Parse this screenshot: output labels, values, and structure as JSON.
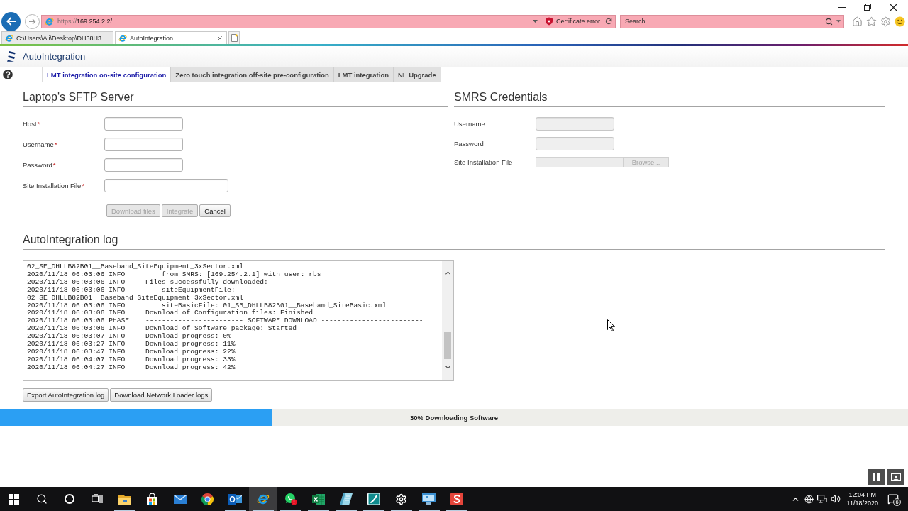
{
  "browser": {
    "tabs": [
      {
        "label": "C:\\Users\\Ali\\Desktop\\DH38H3...",
        "selected": false
      },
      {
        "label": "AutoIntegration",
        "selected": true
      }
    ],
    "address": {
      "scheme": "https://",
      "host": "169.254.2.2/"
    },
    "certificate": "Certificate error",
    "search": {
      "placeholder": "Search..."
    }
  },
  "app": {
    "title": "AutoIntegration"
  },
  "tabs": [
    {
      "label": "LMT integration on-site configuration",
      "selected": true
    },
    {
      "label": "Zero touch integration off-site pre-configuration",
      "selected": false
    },
    {
      "label": "LMT integration",
      "selected": false
    },
    {
      "label": "NL Upgrade",
      "selected": false
    }
  ],
  "required_mark": "*",
  "sftp_server": {
    "title": "Laptop's SFTP Server",
    "fields": [
      {
        "label": "Host",
        "required": true,
        "disabled": false,
        "kind": "text"
      },
      {
        "label": "Username",
        "required": true,
        "disabled": false,
        "kind": "text"
      },
      {
        "label": "Password",
        "required": true,
        "disabled": false,
        "kind": "text"
      },
      {
        "label": "Site Installation File",
        "required": true,
        "disabled": false,
        "kind": "path"
      }
    ],
    "buttons": [
      {
        "label": "Download files",
        "disabled": true
      },
      {
        "label": "Integrate",
        "disabled": true
      },
      {
        "label": "Cancel",
        "disabled": false
      }
    ]
  },
  "smrs_credentials": {
    "title": "SMRS Credentials",
    "fields": [
      {
        "label": "Username",
        "required": false,
        "disabled": true,
        "kind": "text"
      },
      {
        "label": "Password",
        "required": false,
        "disabled": true,
        "kind": "text"
      },
      {
        "label": "Site Installation File",
        "required": false,
        "disabled": true,
        "kind": "file",
        "button": "Browse..."
      }
    ]
  },
  "log": {
    "title": "AutoIntegration log",
    "lines": [
      "02_SE_DHLLB82B01__Baseband_SiteEquipment_3xSector.xml",
      "2020/11/18 06:03:06 INFO         from SMRS: [169.254.2.1] with user: rbs",
      "2020/11/18 06:03:06 INFO     Files successfully downloaded:",
      "2020/11/18 06:03:06 INFO         siteEquipmentFile:",
      "02_SE_DHLLB82B01__Baseband_SiteEquipment_3xSector.xml",
      "2020/11/18 06:03:06 INFO         siteBasicFile: 01_SB_DHLLB82B01__Baseband_SiteBasic.xml",
      "2020/11/18 06:03:06 INFO     Download of Configuration files: Finished",
      "2020/11/18 06:03:06 PHASE    ------------------------ SOFTWARE DOWNLOAD -------------------------",
      "2020/11/18 06:03:06 INFO     Download of Software package: Started",
      "2020/11/18 06:03:07 INFO     Download progress: 0%",
      "2020/11/18 06:03:27 INFO     Download progress: 11%",
      "2020/11/18 06:03:47 INFO     Download progress: 22%",
      "2020/11/18 06:04:07 INFO     Download progress: 33%",
      "2020/11/18 06:04:27 INFO     Download progress: 42%"
    ],
    "buttons": [
      "Export AutoIntegration log",
      "Download Network Loader logs"
    ]
  },
  "progress": {
    "level": 0.3,
    "label": "30% Downloading Software"
  },
  "taskbar": {
    "apps": [
      {
        "kind": "folder",
        "running": true,
        "active": false
      },
      {
        "kind": "store",
        "running": false,
        "active": false
      },
      {
        "kind": "mail",
        "running": false,
        "active": false
      },
      {
        "kind": "chrome",
        "running": false,
        "active": false
      },
      {
        "kind": "outlook",
        "running": true,
        "active": false
      },
      {
        "kind": "ie",
        "running": true,
        "active": true
      },
      {
        "kind": "whatsapp",
        "running": true,
        "active": false
      },
      {
        "kind": "excel",
        "running": true,
        "active": false
      },
      {
        "kind": "book",
        "running": true,
        "active": false
      },
      {
        "kind": "swoosh",
        "running": true,
        "active": false
      },
      {
        "kind": "settings",
        "running": true,
        "active": false
      },
      {
        "kind": "remote",
        "running": true,
        "active": false
      },
      {
        "kind": "tile",
        "running": true,
        "active": false
      }
    ],
    "time": "12:04 PM",
    "date": "11/18/2020",
    "notifications": "6"
  }
}
